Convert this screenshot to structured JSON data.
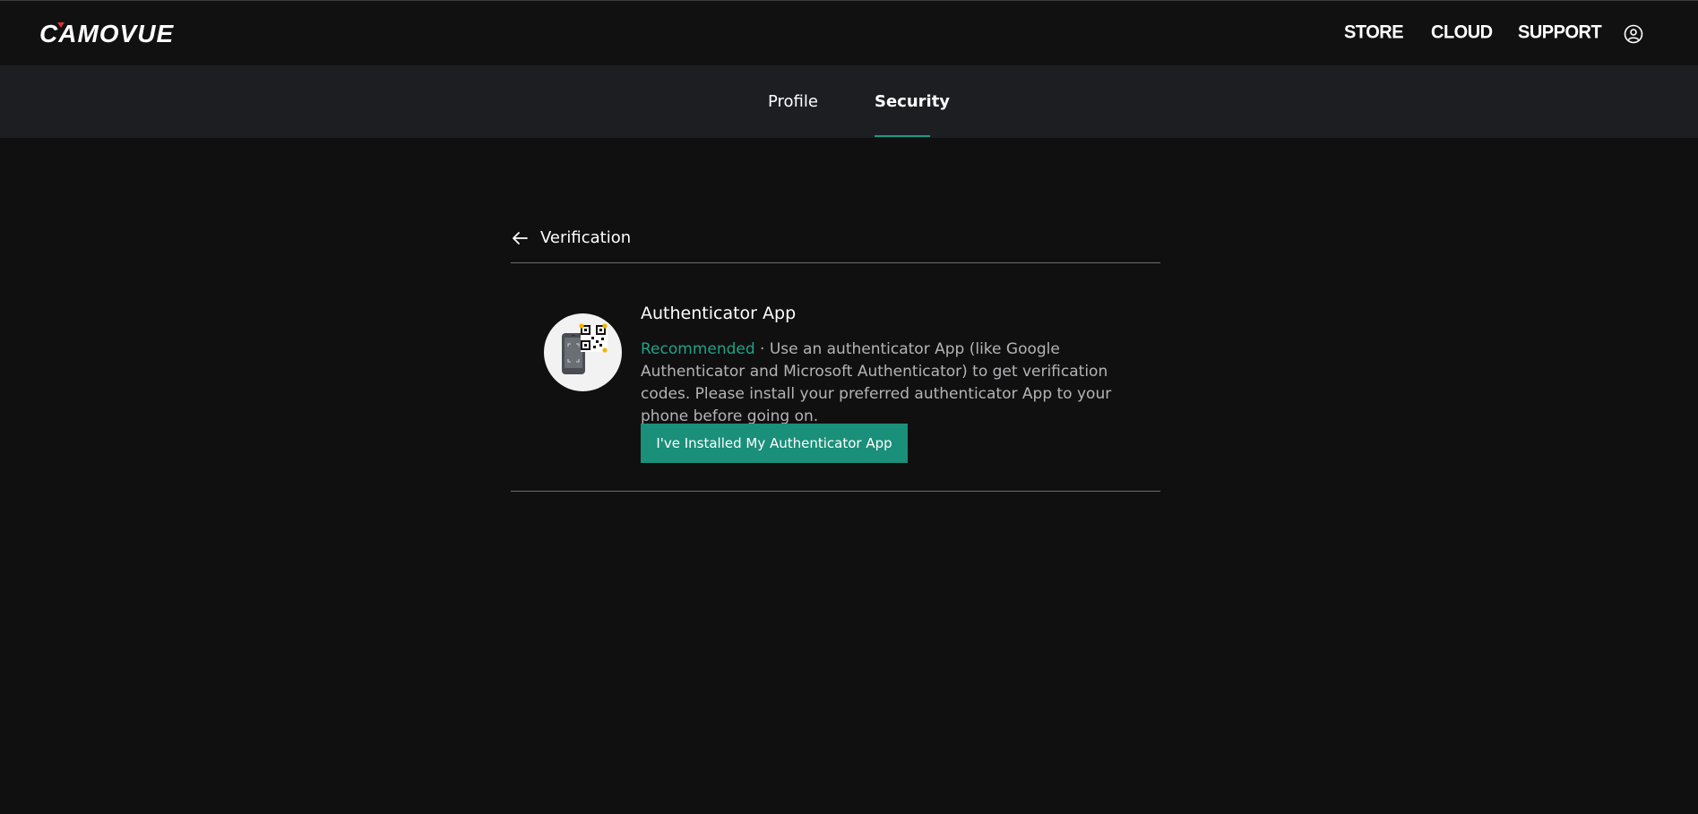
{
  "header": {
    "logo_text": "CAMOVUE",
    "nav": {
      "store": "STORE",
      "cloud": "CLOUD",
      "support": "SUPPORT"
    },
    "user_icon": "user-circle-icon"
  },
  "tabs": {
    "profile": "Profile",
    "security": "Security",
    "active": "Security"
  },
  "verification": {
    "back_icon": "arrow-left-icon",
    "title": "Verification"
  },
  "authenticator": {
    "icon": "phone-qr-icon",
    "title": "Authenticator App",
    "recommended_label": "Recommended",
    "description": " · Use an authenticator App (like Google Authenticator and Microsoft Authenticator) to get verification codes. Please install your preferred authenticator App to your phone before going on.",
    "button_label": "I've Installed My Authenticator App"
  },
  "colors": {
    "background": "#101011",
    "subnav": "#1c1e22",
    "accent": "#1a8f79",
    "recommended": "#1fa286"
  }
}
